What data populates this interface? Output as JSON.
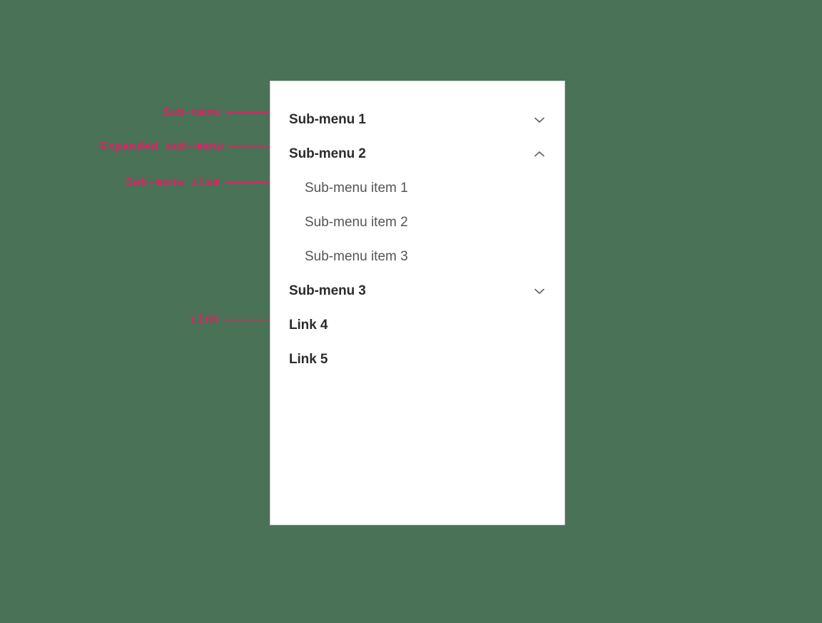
{
  "annotations": {
    "sub_menu": "Sub-menu",
    "expanded_sub_menu": "Expanded sub-menu",
    "sub_menu_item": "Sub-menu item",
    "link": "Link"
  },
  "menu": {
    "items": [
      {
        "label": "Sub-menu 1",
        "type": "submenu",
        "expanded": false
      },
      {
        "label": "Sub-menu 2",
        "type": "submenu",
        "expanded": true,
        "sub_items": [
          {
            "label": "Sub-menu item 1"
          },
          {
            "label": "Sub-menu item 2"
          },
          {
            "label": "Sub-menu item 3"
          }
        ]
      },
      {
        "label": "Sub-menu 3",
        "type": "submenu",
        "expanded": false
      },
      {
        "label": "Link 4",
        "type": "link"
      },
      {
        "label": "Link 5",
        "type": "link"
      }
    ]
  }
}
